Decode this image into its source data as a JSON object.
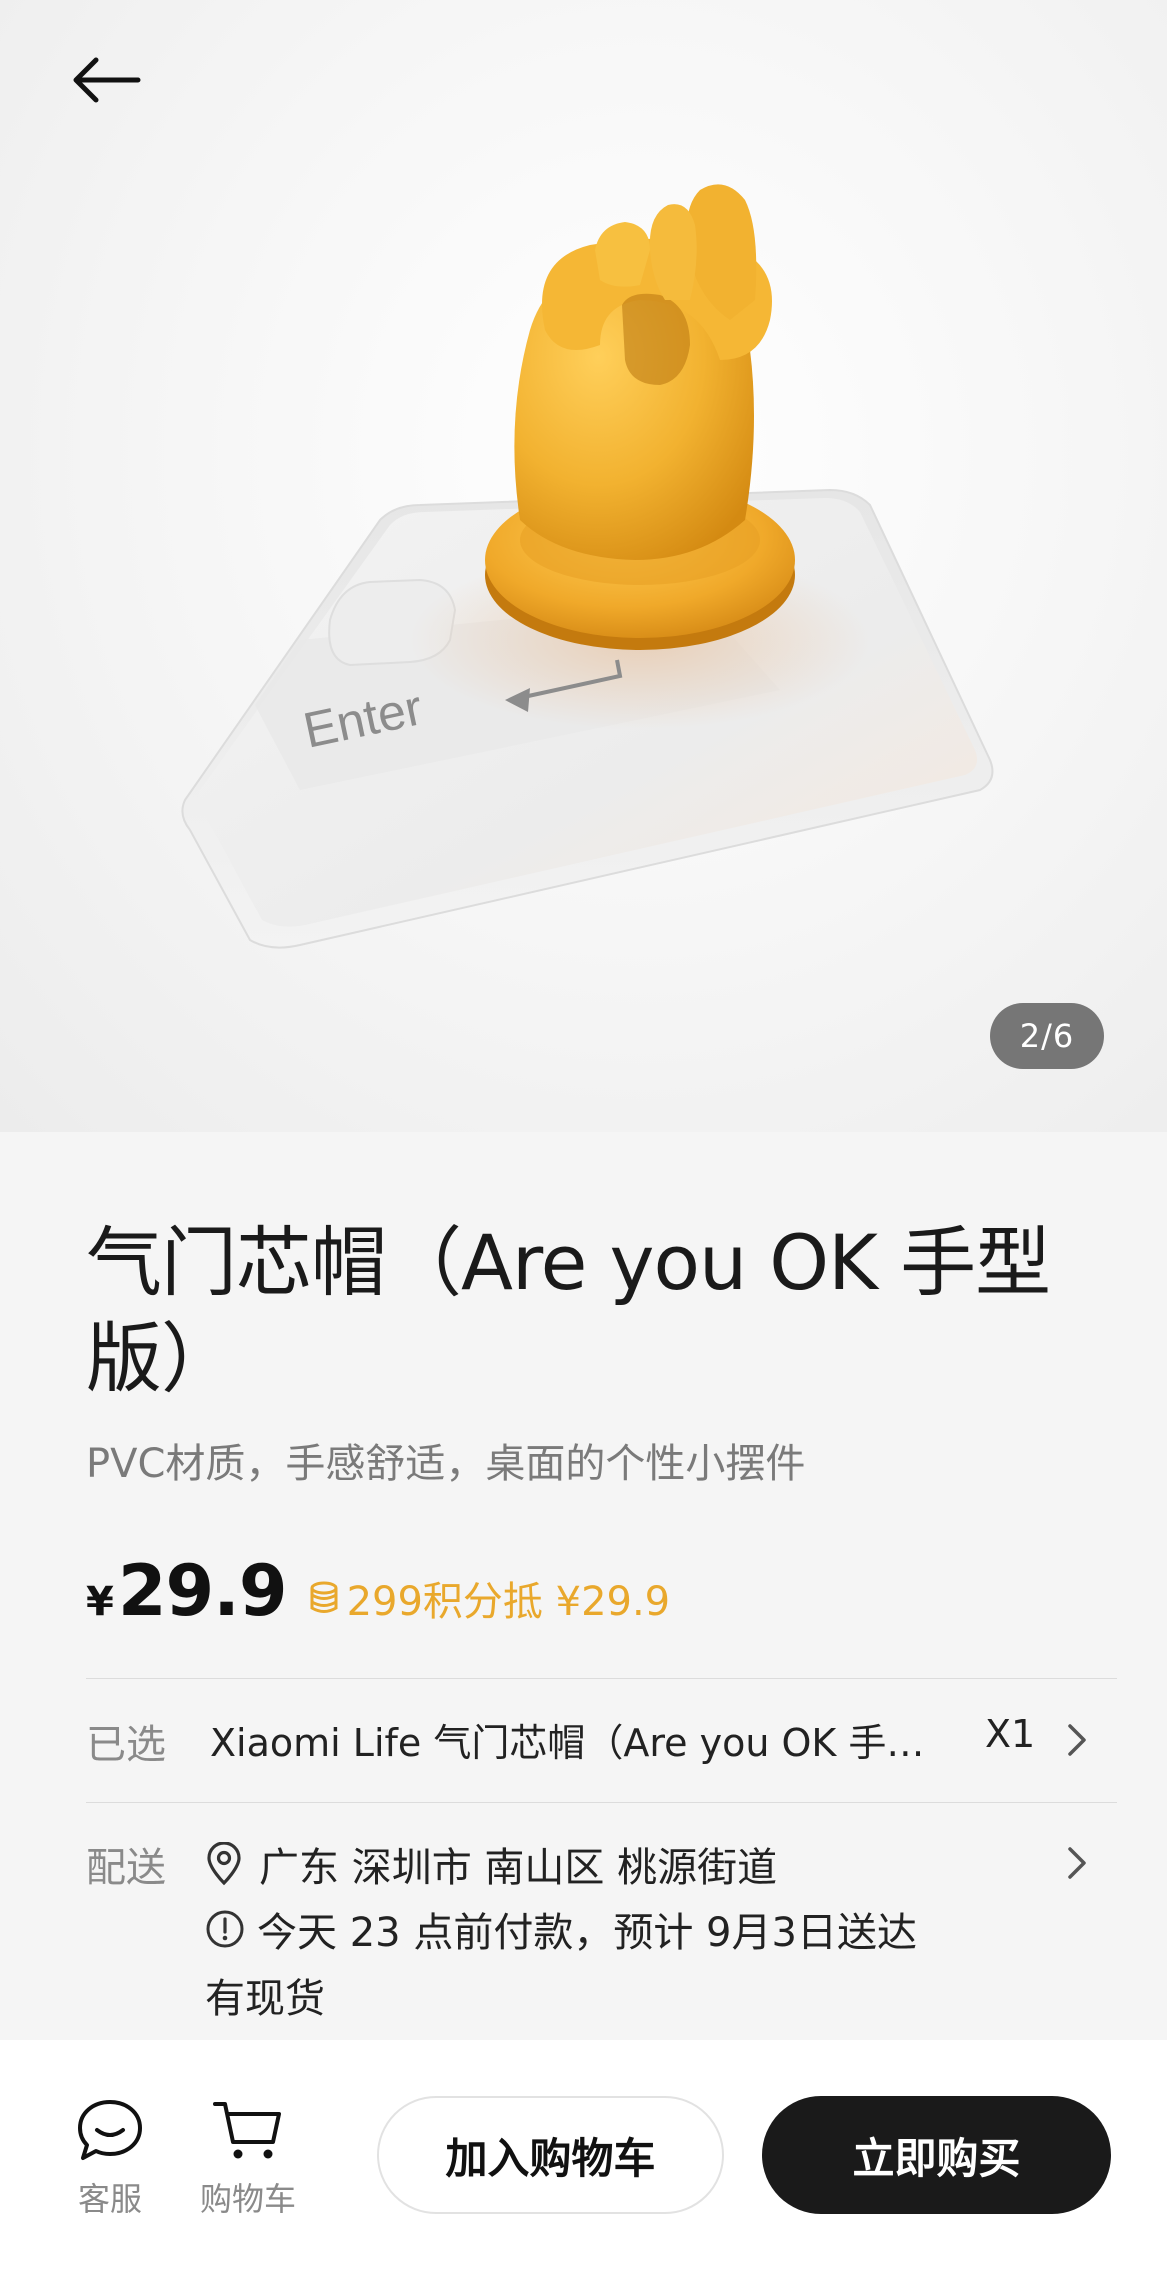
{
  "hero": {
    "page_indicator": "2/6",
    "key_label": "Enter"
  },
  "product": {
    "title": "气门芯帽（Are you OK 手型版）",
    "subtitle": "PVC材质，手感舒适，桌面的个性小摆件",
    "currency": "¥",
    "price": "29.9",
    "points_text": "299积分抵 ¥29.9"
  },
  "selected": {
    "label": "已选",
    "value": "Xiaomi Life 气门芯帽（Are you OK 手…",
    "qty": "X1"
  },
  "delivery": {
    "label": "配送",
    "address": "广东  深圳市  南山区  桃源街道",
    "eta": "今天 23 点前付款，预计 9月3日送达",
    "stock": "有现货"
  },
  "bottom_bar": {
    "service_label": "客服",
    "cart_label": "购物车",
    "add_to_cart": "加入购物车",
    "buy_now": "立即购买"
  },
  "colors": {
    "accent_gold": "#e9a82c",
    "buy_button": "#1a1a1a",
    "hand_yellow": "#f2b230"
  }
}
